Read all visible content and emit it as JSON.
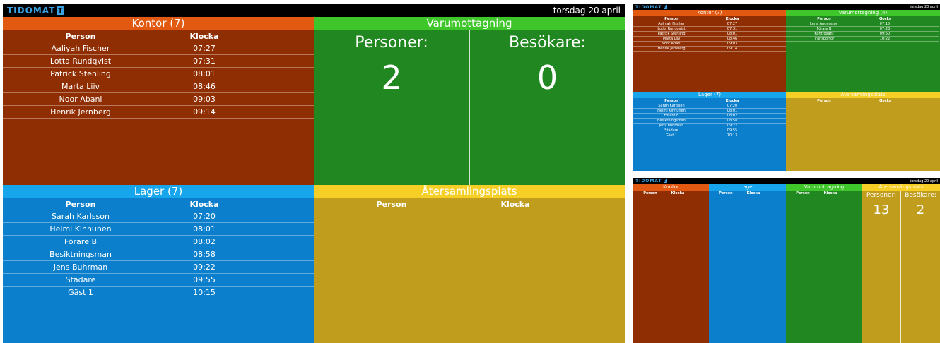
{
  "app": {
    "logo_text": "TIDOMAT",
    "logo_mark": "T"
  },
  "main": {
    "date": "torsdag 20 april",
    "kontor": {
      "title": "Kontor (7)",
      "col_person": "Person",
      "col_clock": "Klocka",
      "rows": [
        {
          "person": "Aaliyah Fischer",
          "clock": "07:27"
        },
        {
          "person": "Lotta Rundqvist",
          "clock": "07:31"
        },
        {
          "person": "Patrick Stenling",
          "clock": "08:01"
        },
        {
          "person": "Marta Liiv",
          "clock": "08:46"
        },
        {
          "person": "Noor Abani",
          "clock": "09:03"
        },
        {
          "person": "Henrik Jernberg",
          "clock": "09:14"
        }
      ]
    },
    "varu": {
      "title": "Varumottagning",
      "persons_label": "Personer:",
      "persons_value": "2",
      "visitors_label": "Besökare:",
      "visitors_value": "0"
    },
    "lager": {
      "title": "Lager (7)",
      "col_person": "Person",
      "col_clock": "Klocka",
      "rows": [
        {
          "person": "Sarah Karlsson",
          "clock": "07:20"
        },
        {
          "person": "Helmi Kinnunen",
          "clock": "08:01"
        },
        {
          "person": "Förare B",
          "clock": "08:02"
        },
        {
          "person": "Besiktningsman",
          "clock": "08:58"
        },
        {
          "person": "Jens Buhrman",
          "clock": "09:22"
        },
        {
          "person": "Städare",
          "clock": "09:55"
        },
        {
          "person": "Gäst 1",
          "clock": "10:15"
        }
      ]
    },
    "ater": {
      "title": "Återsamlingsplats",
      "col_person": "Person",
      "col_clock": "Klocka"
    }
  },
  "small1": {
    "date": "torsdag 20 april",
    "kontor": {
      "title": "Kontor (7)",
      "col_person": "Person",
      "col_clock": "Klocka",
      "rows": [
        {
          "person": "Aaliyah Fischer",
          "clock": "07:27"
        },
        {
          "person": "Lotta Rundqvist",
          "clock": "07:31"
        },
        {
          "person": "Patrick Stenling",
          "clock": "08:01"
        },
        {
          "person": "Marta Liiv",
          "clock": "08:46"
        },
        {
          "person": "Noor Abani",
          "clock": "09:03"
        },
        {
          "person": "Henrik Jernberg",
          "clock": "09:14"
        }
      ]
    },
    "varu": {
      "title": "Varumottagning (4)",
      "col_person": "Person",
      "col_clock": "Klocka",
      "rows": [
        {
          "person": "Lena Andersson",
          "clock": "07:15"
        },
        {
          "person": "Förare B",
          "clock": "07:23"
        },
        {
          "person": "Kontrollant",
          "clock": "09:50"
        },
        {
          "person": "Transportör",
          "clock": "10:22"
        }
      ]
    },
    "lager": {
      "title": "Lager (7)",
      "col_person": "Person",
      "col_clock": "Klocka",
      "rows": [
        {
          "person": "Sarah Karlsson",
          "clock": "07:20"
        },
        {
          "person": "Helmi Kinnunen",
          "clock": "08:01"
        },
        {
          "person": "Förare B",
          "clock": "08:02"
        },
        {
          "person": "Besiktningsman",
          "clock": "08:58"
        },
        {
          "person": "Jens Buhrman",
          "clock": "09:22"
        },
        {
          "person": "Städare",
          "clock": "09:55"
        },
        {
          "person": "Gäst 1",
          "clock": "10:13"
        }
      ]
    },
    "ater": {
      "title": "Återsamlingsplats",
      "col_person": "Person",
      "col_clock": "Klocka"
    }
  },
  "small2": {
    "date": "torsdag 20 april",
    "kontor": {
      "title": "Kontor",
      "col_person": "Person",
      "col_clock": "Klocka"
    },
    "lager": {
      "title": "Lager",
      "col_person": "Person",
      "col_clock": "Klocka"
    },
    "varu": {
      "title": "Varumottagning",
      "col_person": "Person",
      "col_clock": "Klocka"
    },
    "ater": {
      "title": "Återsamlingsplats",
      "persons_label": "Personer:",
      "persons_value": "13",
      "visitors_label": "Besökare:",
      "visitors_value": "2"
    }
  },
  "colors": {
    "kontor_header": "#e25a12",
    "kontor_body": "#8f2e02",
    "varu_header": "#3fc62b",
    "varu_body": "#218720",
    "lager_header": "#17a6ec",
    "lager_body": "#0b7fcb",
    "ater_header": "#f5cf25",
    "ater_body": "#c19d1e",
    "logo_blue": "#3aa0e0"
  }
}
